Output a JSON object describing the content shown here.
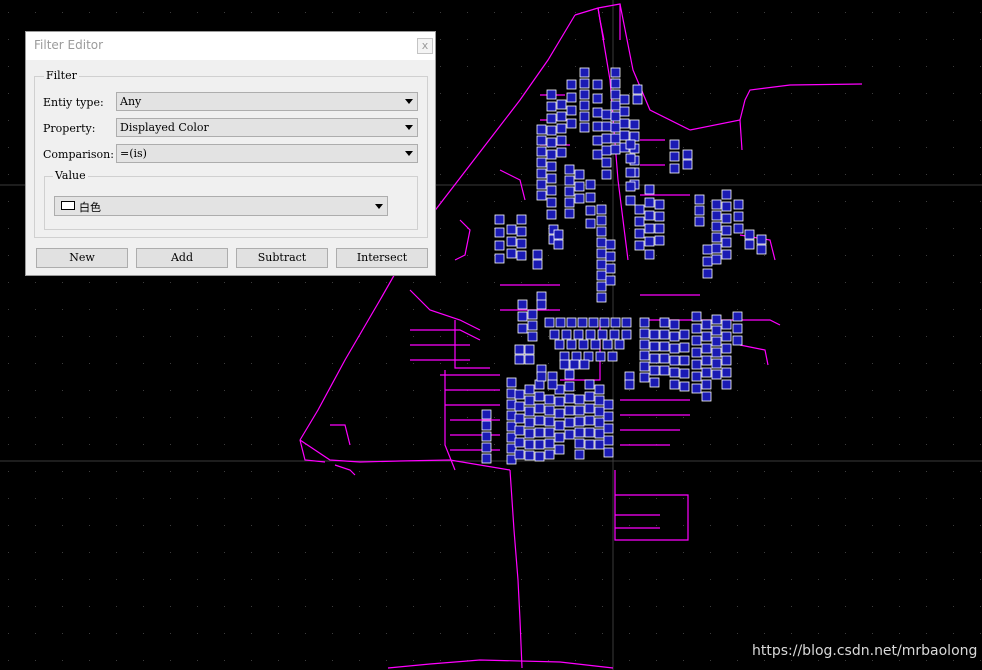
{
  "dialog": {
    "title": "Filter Editor",
    "close_glyph": "x",
    "filter_legend": "Filter",
    "entity_type": {
      "label": "Entiy type:",
      "value": "Any"
    },
    "property": {
      "label": "Property:",
      "value": "Displayed Color"
    },
    "comparison": {
      "label": "Comparison:",
      "value": "=(is)"
    },
    "value_legend": "Value",
    "value_select": {
      "value": "白色",
      "swatch_color": "#ffffff"
    },
    "buttons": {
      "new": "New",
      "add": "Add",
      "subtract": "Subtract",
      "intersect": "Intersect"
    }
  },
  "canvas": {
    "background_color": "#000000",
    "line_color": "#ff00ff",
    "block_fill_color": "#1a1ab4",
    "block_border_color": "#ffffff",
    "grid_dot_color": "#3c3c3c"
  },
  "watermark": "https://blog.csdn.net/mrbaolong"
}
